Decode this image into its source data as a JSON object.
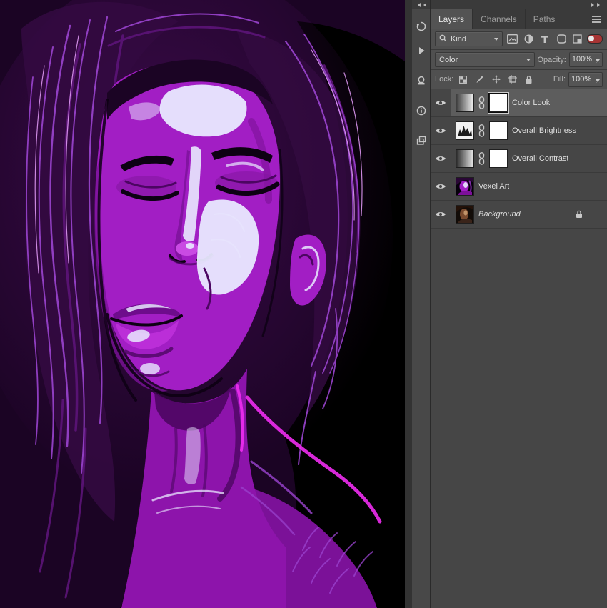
{
  "artwork": {
    "palette": {
      "bg": "#000000",
      "hair_dark": "#1b0424",
      "hair_mid": "#330a40",
      "strand": "#9b44d0",
      "strand_bright": "#dd97f2",
      "strand_dark": "#5c1478",
      "skin": "#a21ec4",
      "skin_shadow": "#7b1198",
      "skin_deep": "#4c0662",
      "line": "#0d0113",
      "highlight": "#e9e9ff",
      "lip": "#bb2ed8",
      "lip_dark": "#6e0c8c",
      "rim": "#ee2cf0",
      "glow": "#5b1070"
    }
  },
  "dock": {
    "icons": [
      "history-panel-icon",
      "actions-panel-icon",
      "clone-source-panel-icon",
      "info-panel-icon",
      "layer-comps-panel-icon"
    ]
  },
  "layers_panel": {
    "tabs": [
      {
        "label": "Layers",
        "active": true
      },
      {
        "label": "Channels",
        "active": false
      },
      {
        "label": "Paths",
        "active": false
      }
    ],
    "filter": {
      "kind": "Kind",
      "icons": [
        "pixel-layer-filter-icon",
        "adjustment-layer-filter-icon",
        "type-layer-filter-icon",
        "shape-layer-filter-icon",
        "smart-object-filter-icon"
      ],
      "toggle_state": "on"
    },
    "blend": {
      "mode": "Color",
      "opacity_label": "Opacity:",
      "opacity": "100%"
    },
    "lock": {
      "label": "Lock:",
      "icons": [
        "lock-transparent-icon",
        "lock-pixels-icon",
        "lock-position-icon",
        "lock-artboard-icon",
        "lock-all-icon"
      ],
      "fill_label": "Fill:",
      "fill": "100%"
    },
    "rows": [
      {
        "name": "Color Look",
        "kind": "adjustment",
        "thumbnail": "gradient-map",
        "mask": true,
        "selected": true,
        "visible": true
      },
      {
        "name": "Overall Brightness",
        "kind": "adjustment",
        "thumbnail": "levels",
        "mask": true,
        "selected": false,
        "visible": true
      },
      {
        "name": "Overall Contrast",
        "kind": "adjustment",
        "thumbnail": "gradient-map",
        "mask": true,
        "selected": false,
        "visible": true
      },
      {
        "name": "Vexel Art",
        "kind": "image",
        "thumbnail": "vexel-art",
        "selected": false,
        "visible": true
      },
      {
        "name": "Background",
        "kind": "image",
        "thumbnail": "background-photo",
        "selected": false,
        "visible": true,
        "locked": true,
        "italic": true
      }
    ]
  }
}
